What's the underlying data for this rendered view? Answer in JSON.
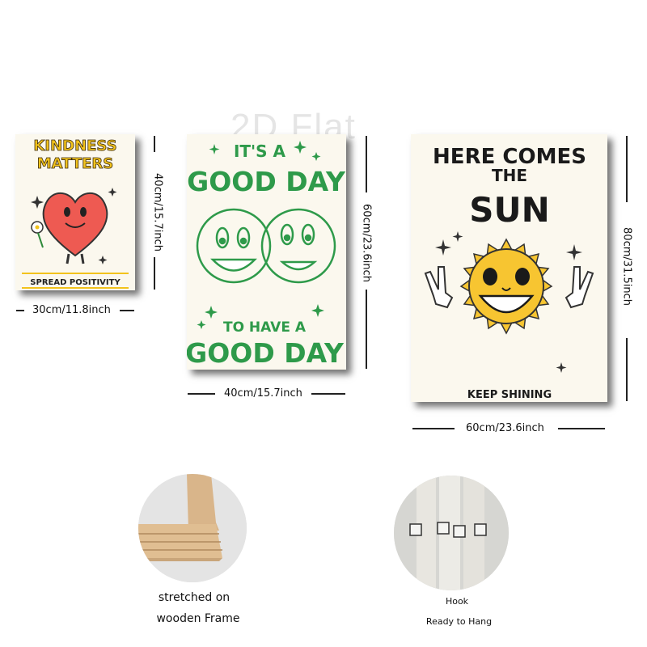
{
  "watermark": "2D Flat",
  "posters": {
    "kindness": {
      "title_line1": "KINDNESS",
      "title_line2": "MATTERS",
      "footer": "SPREAD POSITIVITY",
      "width_label": "30cm/11.8inch",
      "height_label": "40cm/15.7inch"
    },
    "goodday": {
      "top_line1": "IT'S A",
      "top_line2": "GOOD DAY",
      "bottom_line1": "TO HAVE A",
      "bottom_line2": "GOOD DAY",
      "width_label": "40cm/15.7inch",
      "height_label": "60cm/23.6inch"
    },
    "sun": {
      "title_line1": "HERE COMES",
      "title_line2": "THE",
      "title_line3": "SUN",
      "footer": "KEEP SHINING",
      "width_label": "60cm/23.6inch",
      "height_label": "80cm/31.5inch"
    }
  },
  "features": {
    "frame": {
      "line1": "stretched on",
      "line2": "wooden Frame"
    },
    "hook": {
      "line1": "Hook",
      "line2": "Ready to Hang"
    }
  },
  "colors": {
    "heart": "#ee5a52",
    "kindness_title": "#f2c31c",
    "goodday_green": "#2e9a4a",
    "sun_yellow": "#f7c531",
    "ink": "#1a1a1a"
  }
}
